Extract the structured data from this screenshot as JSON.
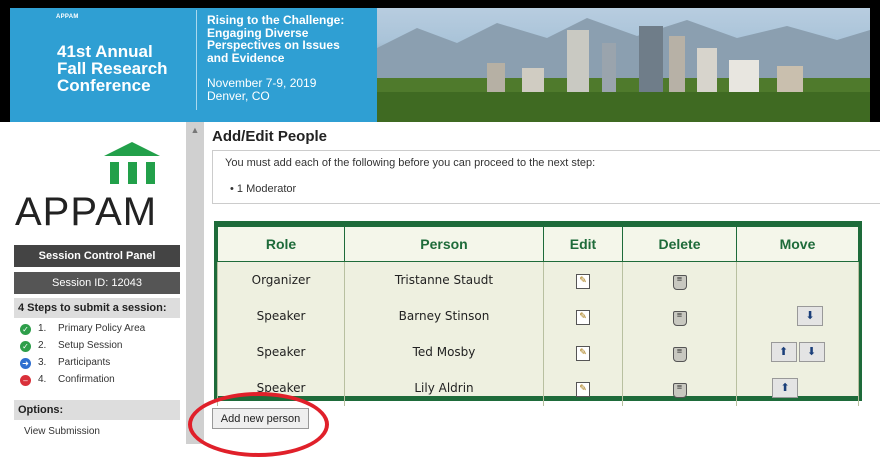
{
  "banner": {
    "org_small": "APPAM",
    "conference_lines": [
      "41st Annual",
      "Fall Research",
      "Conference"
    ],
    "theme_lines": [
      "Rising to the Challenge:",
      "Engaging Diverse",
      "Perspectives on Issues",
      "and Evidence"
    ],
    "dates": "November 7-9, 2019",
    "location": "Denver, CO"
  },
  "sidebar": {
    "logo_text": "APPAM",
    "control_panel_label": "Session Control Panel",
    "session_id": "Session ID: 12043",
    "steps_title": "4 Steps to submit a session:",
    "steps": [
      {
        "num": "1.",
        "label": "Primary Policy Area",
        "status": "done",
        "color": "#2e9e4a"
      },
      {
        "num": "2.",
        "label": "Setup Session",
        "status": "done",
        "color": "#2e9e4a"
      },
      {
        "num": "3.",
        "label": "Participants",
        "status": "current",
        "color": "#2f6fd0"
      },
      {
        "num": "4.",
        "label": "Confirmation",
        "status": "blocked",
        "color": "#d9303a"
      }
    ],
    "options_title": "Options:",
    "view_submission": "View Submission"
  },
  "main": {
    "title": "Add/Edit People",
    "notice_text": "You must add each of the following before you can proceed to the next step:",
    "notice_item": "• 1 Moderator",
    "table": {
      "headers": [
        "Role",
        "Person",
        "Edit",
        "Delete",
        "Move"
      ],
      "rows": [
        {
          "role": "Organizer",
          "person": "Tristanne Staudt",
          "move": []
        },
        {
          "role": "Speaker",
          "person": "Barney Stinson",
          "move": [
            "down"
          ]
        },
        {
          "role": "Speaker",
          "person": "Ted Mosby",
          "move": [
            "up",
            "down"
          ]
        },
        {
          "role": "Speaker",
          "person": "Lily Aldrin",
          "move": [
            "up"
          ]
        }
      ]
    },
    "add_button": "Add new person"
  },
  "colors": {
    "accent_green": "#1e6b3a",
    "annotation_red": "#e0202a",
    "banner_blue": "#2f9fd3"
  }
}
